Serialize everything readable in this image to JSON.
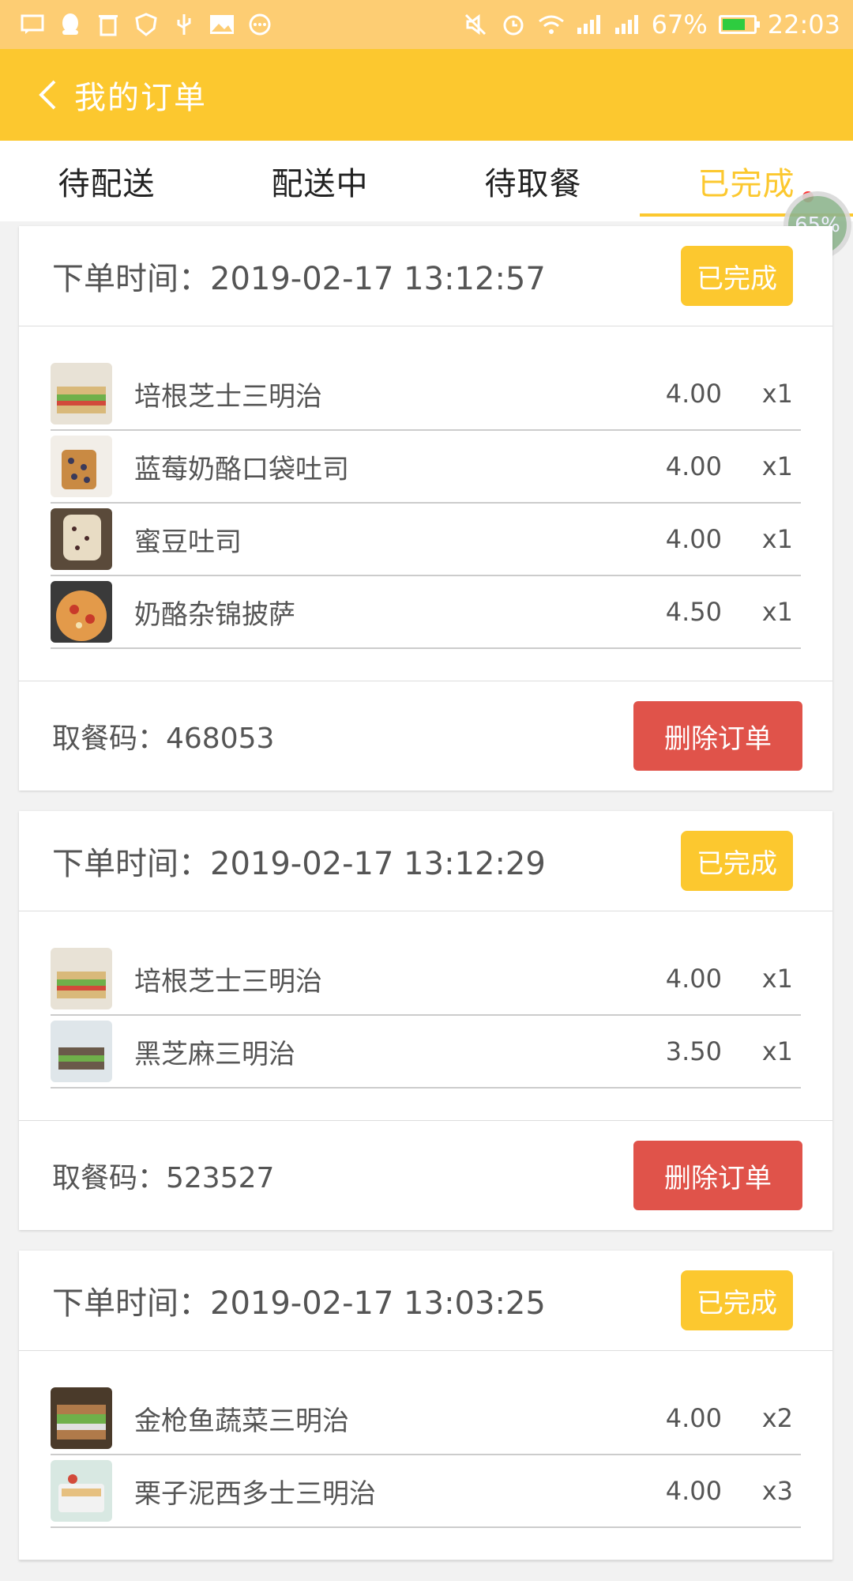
{
  "status_bar": {
    "battery": "67%",
    "time": "22:03",
    "left_icons": [
      "message-icon",
      "qq-icon",
      "trash-icon",
      "shield-icon",
      "usb-icon",
      "image-icon",
      "more-icon"
    ],
    "right_icons": [
      "mute-icon",
      "alarm-icon",
      "wifi-icon",
      "signal-icon",
      "signal-icon"
    ]
  },
  "header": {
    "title": "我的订单"
  },
  "tabs": [
    {
      "label": "待配送"
    },
    {
      "label": "配送中"
    },
    {
      "label": "待取餐"
    },
    {
      "label": "已完成"
    }
  ],
  "floating_badge": "65%",
  "orders": [
    {
      "time_label": "下单时间：2019-02-17 13:12:57",
      "status": "已完成",
      "items": [
        {
          "name": "培根芝士三明治",
          "price": "4.00",
          "qty": "x1"
        },
        {
          "name": "蓝莓奶酪口袋吐司",
          "price": "4.00",
          "qty": "x1"
        },
        {
          "name": "蜜豆吐司",
          "price": "4.00",
          "qty": "x1"
        },
        {
          "name": "奶酪杂锦披萨",
          "price": "4.50",
          "qty": "x1"
        }
      ],
      "pickup": "取餐码：468053",
      "delete_label": "删除订单"
    },
    {
      "time_label": "下单时间：2019-02-17 13:12:29",
      "status": "已完成",
      "items": [
        {
          "name": "培根芝士三明治",
          "price": "4.00",
          "qty": "x1"
        },
        {
          "name": "黑芝麻三明治",
          "price": "3.50",
          "qty": "x1"
        }
      ],
      "pickup": "取餐码：523527",
      "delete_label": "删除订单"
    },
    {
      "time_label": "下单时间：2019-02-17 13:03:25",
      "status": "已完成",
      "items": [
        {
          "name": "金枪鱼蔬菜三明治",
          "price": "4.00",
          "qty": "x2"
        },
        {
          "name": "栗子泥西多士三明治",
          "price": "4.00",
          "qty": "x3"
        }
      ]
    }
  ]
}
